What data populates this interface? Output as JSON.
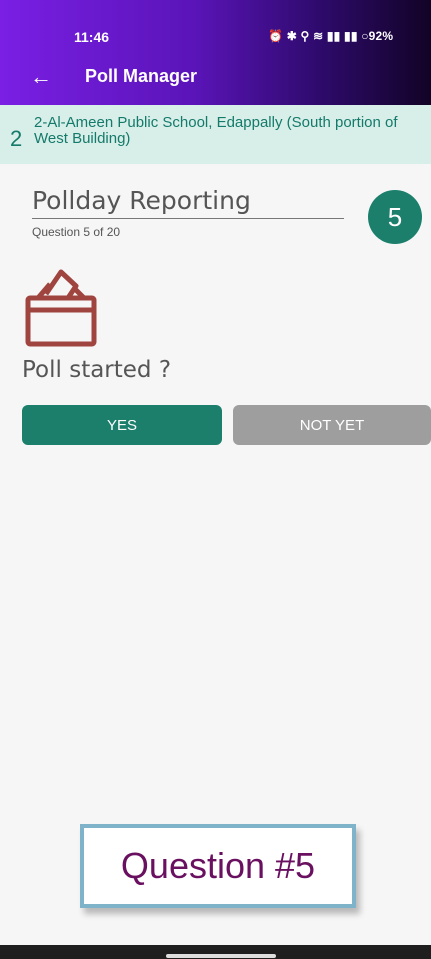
{
  "status_bar": {
    "time": "11:46",
    "icons": [
      "alarm-icon",
      "bluetooth-icon",
      "location-icon",
      "wifi-icon",
      "signal-icon",
      "signal-icon",
      "battery-icon"
    ],
    "battery": "92%"
  },
  "app_bar": {
    "title": "Poll Manager"
  },
  "station": {
    "number": "2",
    "name": "2-Al-Ameen Public School, Edappally (South portion of West Building)"
  },
  "question": {
    "section": "Pollday Reporting",
    "progress": "Question 5 of 20",
    "number": "5",
    "text": "Poll started ?"
  },
  "buttons": {
    "yes": "YES",
    "not_yet": "NOT YET"
  },
  "overlay": {
    "label": "Question #5"
  },
  "colors": {
    "accent": "#1b7f6c",
    "header_start": "#7a1fe4",
    "icon": "#a0443f"
  }
}
